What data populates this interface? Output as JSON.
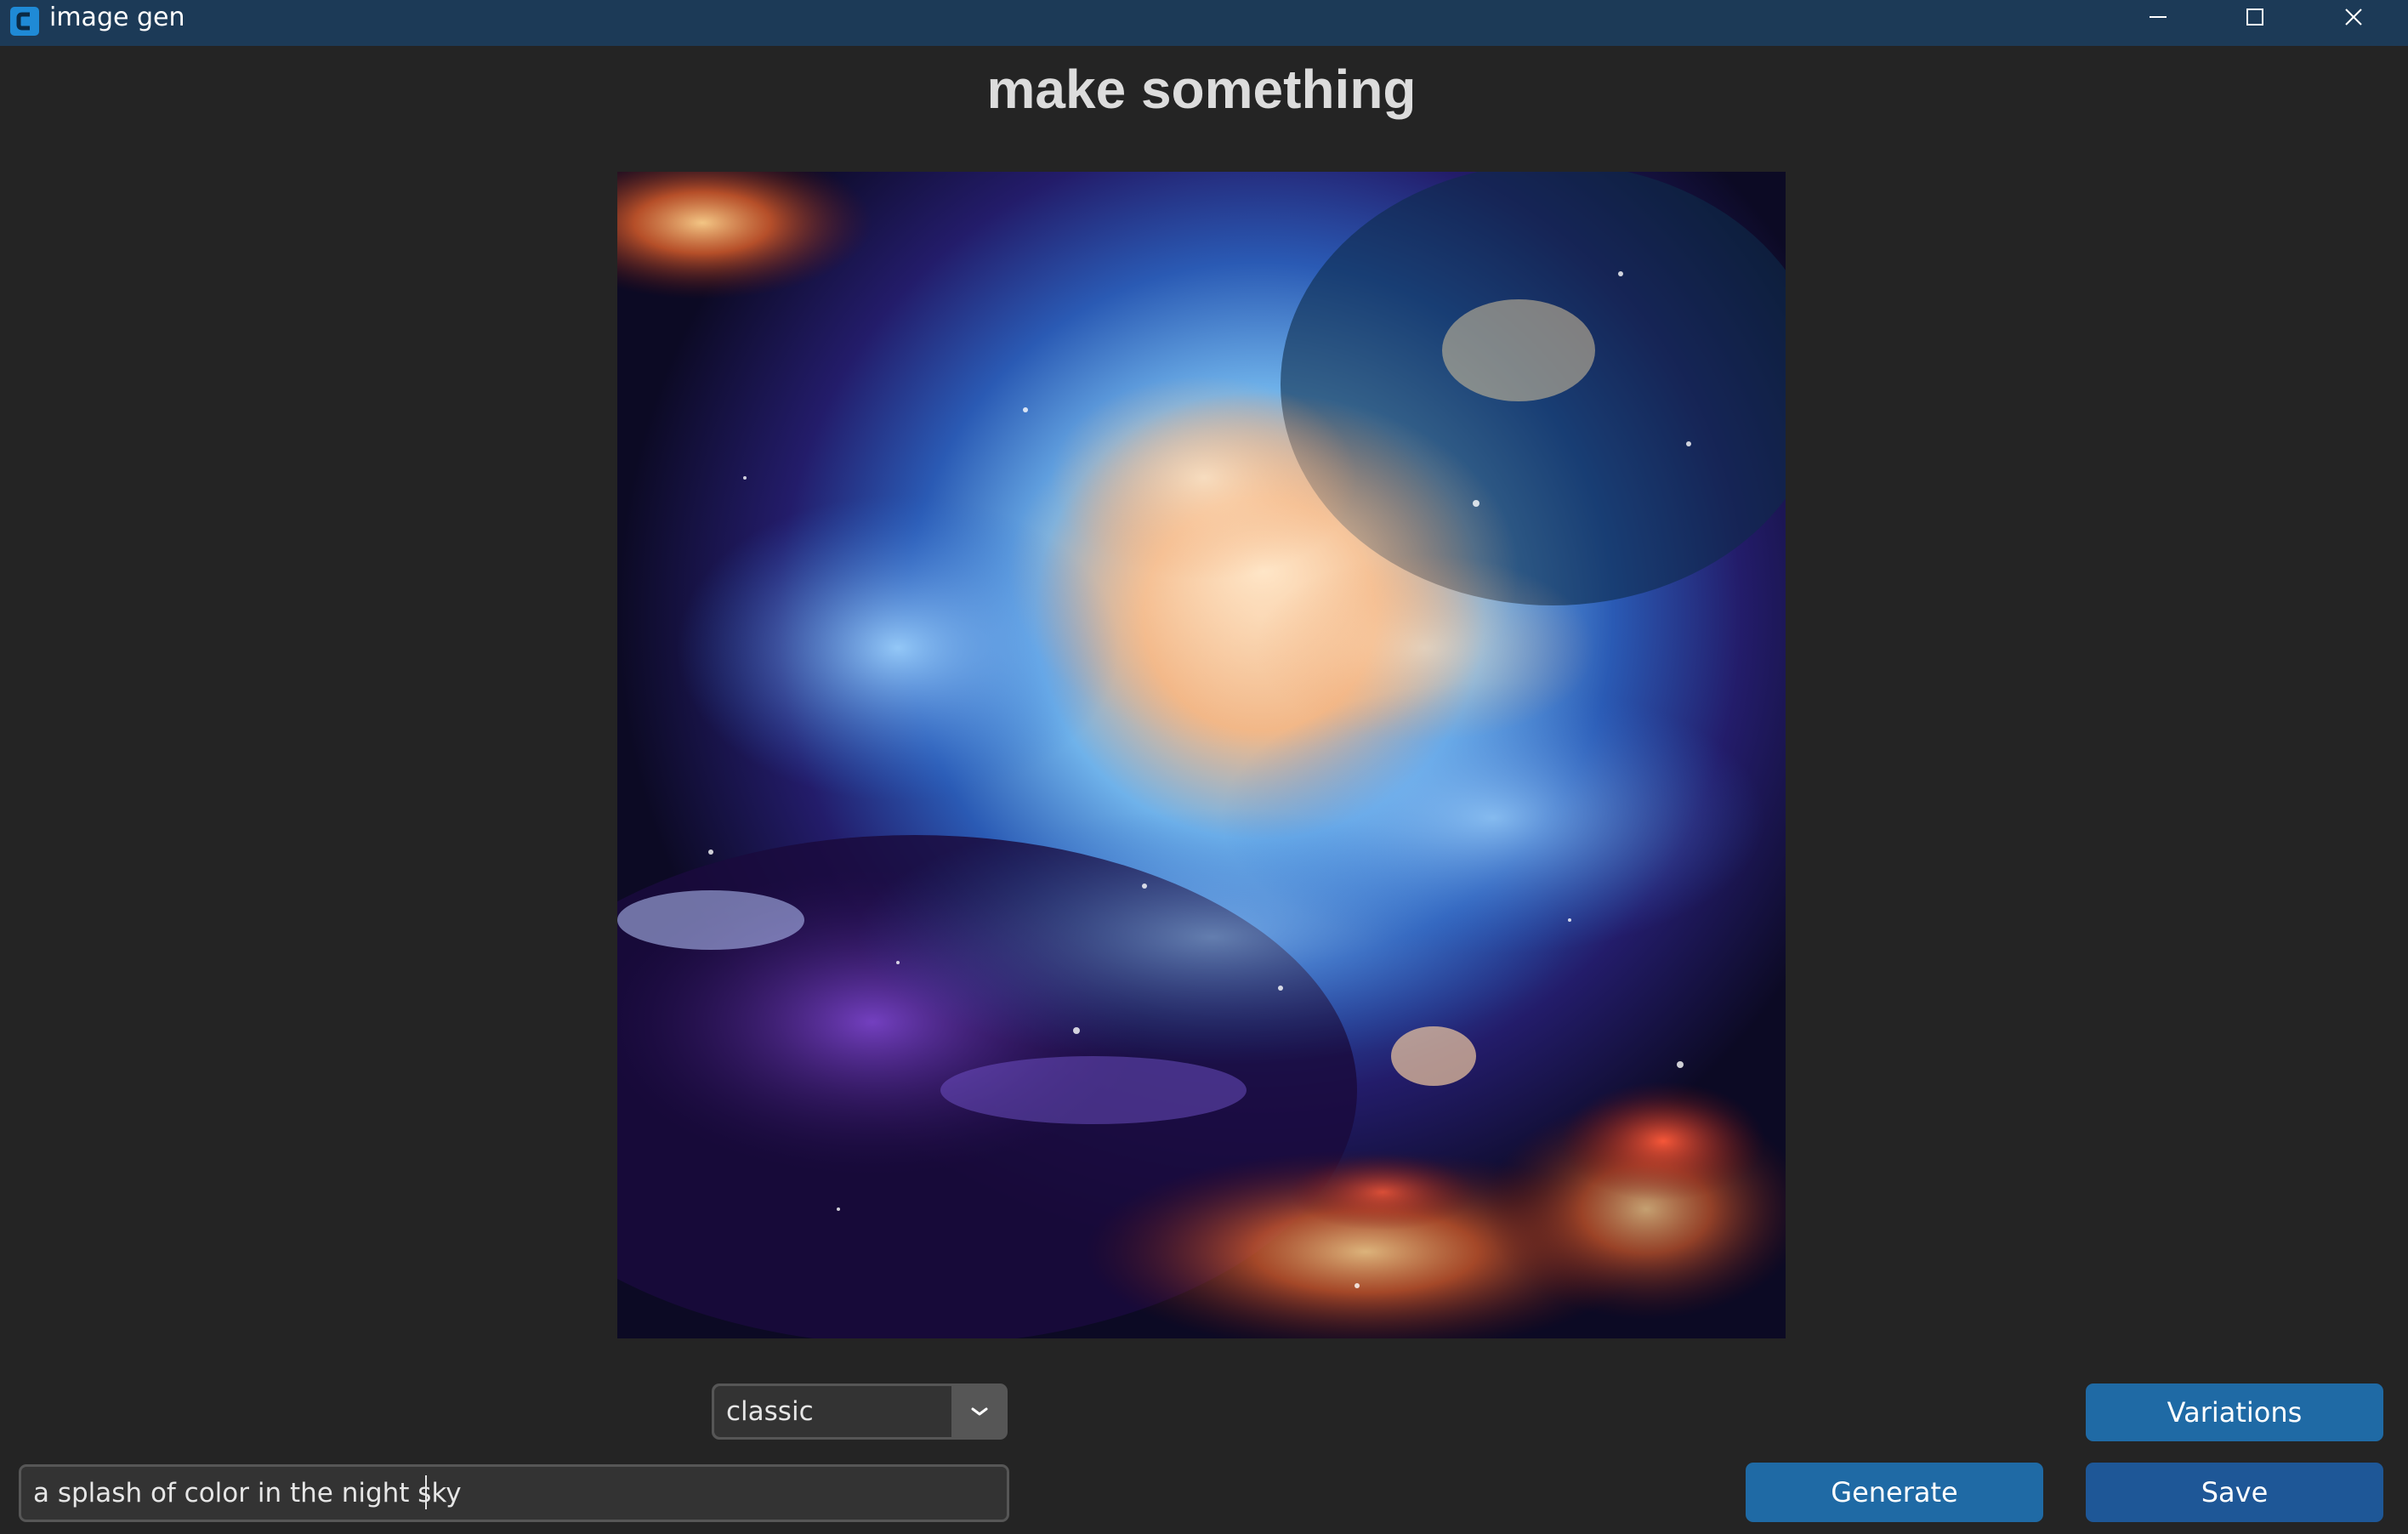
{
  "window": {
    "title": "image gen",
    "icons": [
      "app-icon",
      "minimize-icon",
      "maximize-icon",
      "close-icon"
    ]
  },
  "main": {
    "heading": "make something"
  },
  "canvas": {
    "content": "generated-image"
  },
  "controls": {
    "style_select": {
      "value": "classic",
      "icon": "chevron-down-icon"
    },
    "prompt": {
      "value": "a splash of color in the night sky"
    },
    "buttons": {
      "variations": "Variations",
      "generate": "Generate",
      "save": "Save"
    }
  },
  "colors": {
    "titlebar": "#1c3a57",
    "background": "#242424",
    "button": "#1f6aa5",
    "input_bg": "#333333",
    "input_border": "#565656"
  }
}
